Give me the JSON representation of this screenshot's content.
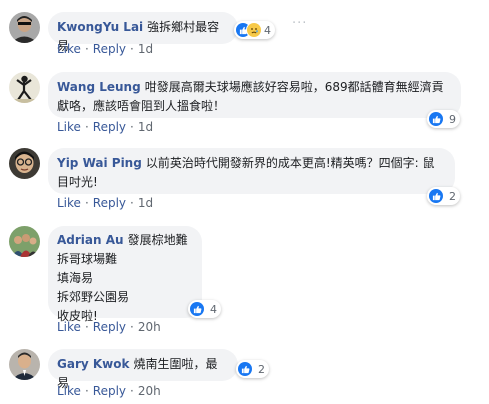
{
  "comments": [
    {
      "author": "KwongYu Lai",
      "text": "強拆鄉村最容易",
      "reaction_count": "4",
      "like": "Like",
      "reply": "Reply",
      "time": "1d"
    },
    {
      "author": "Wang Leung",
      "text": "咁發展高爾夫球場應該好容易啦，689都話體育無經濟貢獻咯，應該唔會阻到人搵食啦！",
      "reaction_count": "9",
      "like": "Like",
      "reply": "Reply",
      "time": "1d"
    },
    {
      "author": "Yip Wai Ping",
      "text": "以前英治時代開發新界的成本更高!精英嗎？四個字: 鼠目吋光!",
      "reaction_count": "2",
      "like": "Like",
      "reply": "Reply",
      "time": "1d"
    },
    {
      "author": "Adrian Au",
      "text_lines": [
        "發展棕地難",
        "拆哥球場難",
        "填海易",
        "拆郊野公園易",
        "收皮啦!"
      ],
      "reaction_count": "4",
      "like": "Like",
      "reply": "Reply",
      "time": "20h"
    },
    {
      "author": "Gary Kwok",
      "text": "燒南生圍啦，最易",
      "reaction_count": "2",
      "like": "Like",
      "reply": "Reply",
      "time": "20h"
    }
  ],
  "more_glyph": "···",
  "separator": "·",
  "colors": {
    "author": "#385898",
    "bubble": "#f2f3f5",
    "like_blue": "#1877f2",
    "meta": "#606770"
  }
}
